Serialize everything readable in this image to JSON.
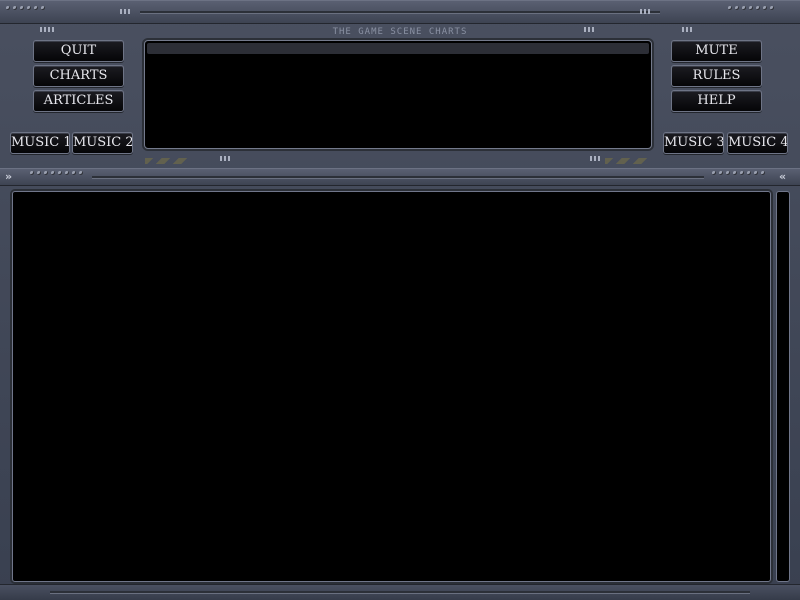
{
  "window": {
    "title": "THE GAME SCENE CHARTS"
  },
  "left_buttons": {
    "quit": "QUIT",
    "charts": "CHARTS",
    "articles": "ARTICLES"
  },
  "right_buttons": {
    "mute": "MUTE",
    "rules": "RULES",
    "help": "HELP"
  },
  "music_buttons": {
    "music1": "MUSIC 1",
    "music2": "MUSIC 2",
    "music3": "MUSIC 3",
    "music4": "MUSIC 4"
  },
  "scroll": {
    "left_chevron": "»",
    "right_chevron": "«"
  },
  "colors": {
    "panel": "#4a5060",
    "screen": "#000000",
    "button_text": "#e8e8ee",
    "title_text": "#8a91a3"
  }
}
